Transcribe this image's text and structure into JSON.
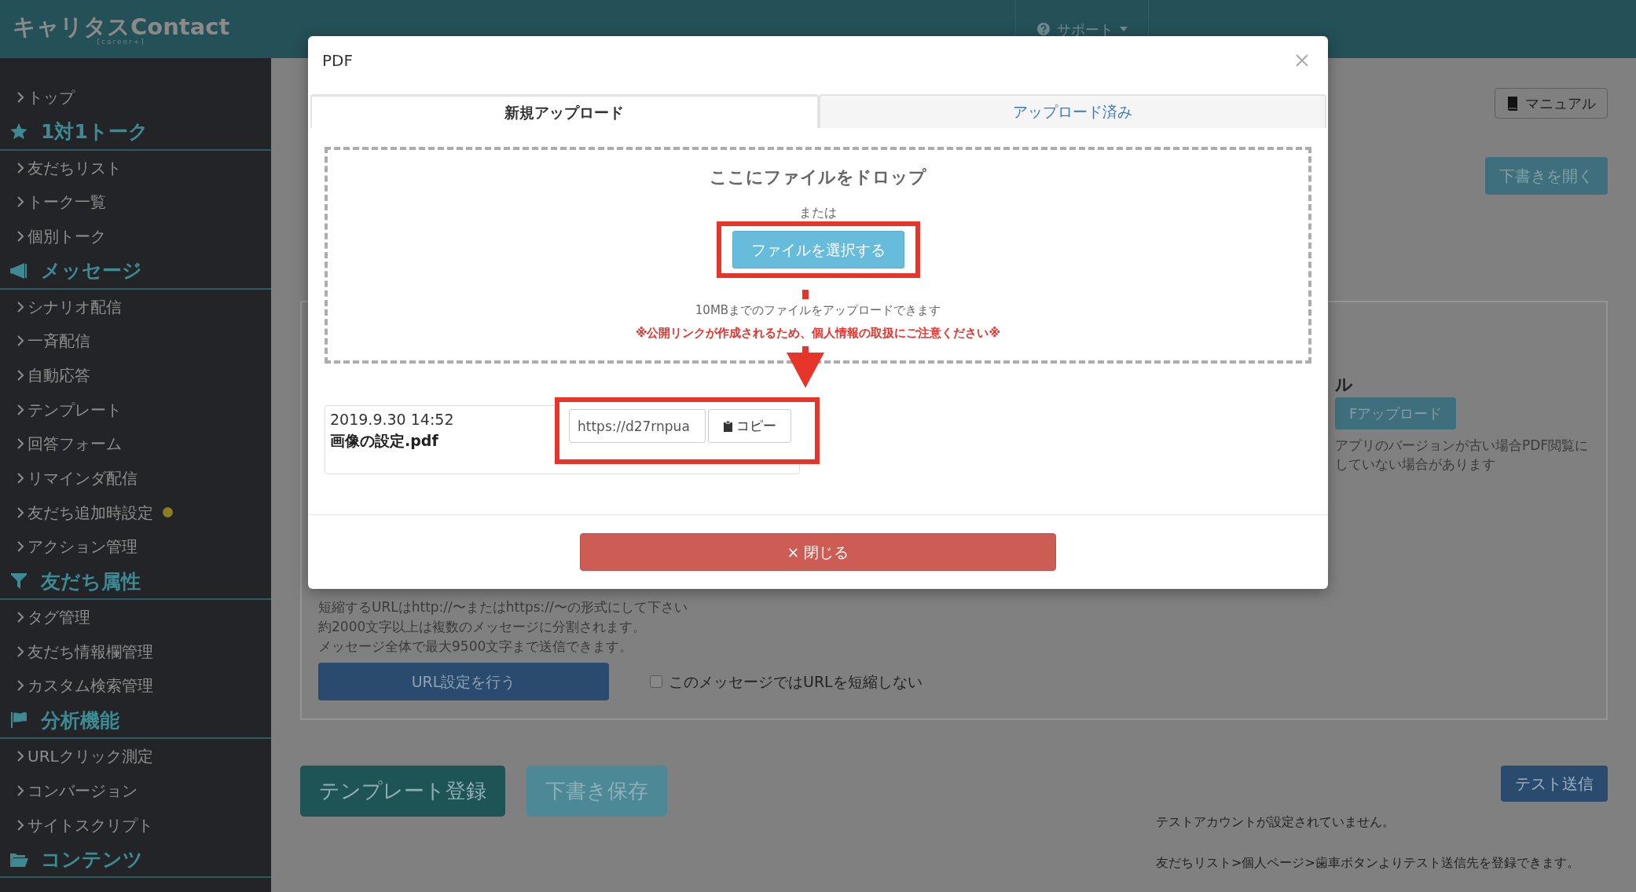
{
  "header": {
    "logo": "キャリタスContact",
    "logo_sub": "[career+]",
    "support_menu": "サポート"
  },
  "sidebar": [
    {
      "kind": "item",
      "label": "トップ",
      "notice": false
    },
    {
      "kind": "heading",
      "label": "1対1トーク"
    },
    {
      "kind": "item",
      "label": "友だちリスト",
      "notice": false
    },
    {
      "kind": "item",
      "label": "トーク一覧",
      "notice": false
    },
    {
      "kind": "item",
      "label": "個別トーク",
      "notice": false
    },
    {
      "kind": "heading",
      "label": "メッセージ"
    },
    {
      "kind": "item",
      "label": "シナリオ配信",
      "notice": false
    },
    {
      "kind": "item",
      "label": "一斉配信",
      "notice": false
    },
    {
      "kind": "item",
      "label": "自動応答",
      "notice": false
    },
    {
      "kind": "item",
      "label": "テンプレート",
      "notice": false
    },
    {
      "kind": "item",
      "label": "回答フォーム",
      "notice": false
    },
    {
      "kind": "item",
      "label": "リマインダ配信",
      "notice": false
    },
    {
      "kind": "item",
      "label": "友だち追加時設定",
      "notice": true
    },
    {
      "kind": "item",
      "label": "アクション管理",
      "notice": false
    },
    {
      "kind": "heading",
      "label": "友だち属性"
    },
    {
      "kind": "item",
      "label": "タグ管理",
      "notice": false
    },
    {
      "kind": "item",
      "label": "友だち情報欄管理",
      "notice": false
    },
    {
      "kind": "item",
      "label": "カスタム検索管理",
      "notice": false
    },
    {
      "kind": "heading",
      "label": "分析機能"
    },
    {
      "kind": "item",
      "label": "URLクリック測定",
      "notice": false
    },
    {
      "kind": "item",
      "label": "コンバージョン",
      "notice": false
    },
    {
      "kind": "item",
      "label": "サイトスクリプト",
      "notice": false
    },
    {
      "kind": "heading",
      "label": "コンテンツ"
    }
  ],
  "page": {
    "manual_button": "マニュアル",
    "open_draft_button": "下書きを開く",
    "panel": {
      "heading": "ル",
      "upload_button": "Fアップロード",
      "notes": [
        "アプリのバージョンが古い場合PDF閲覧に",
        "していない場合があります"
      ],
      "hints": [
        "短縮するURLはhttp://〜またはhttps://〜の形式にして下さい",
        "約2000文字以上は複数のメッセージに分割されます。",
        "メッセージ全体で最大9500文字まで送信できます。"
      ],
      "url_button": "URL設定を行う",
      "shorten_checkbox": {
        "label": "このメッセージではURLを短縮しない",
        "checked": false
      }
    },
    "template_button": "テンプレート登録",
    "save_draft_button": "下書き保存",
    "test_send_button": "テスト送信",
    "test_notes": [
      "テストアカウントが設定されていません。",
      "友だちリスト>個人ページ>歯車ボタンよりテスト送信先を登録できます。"
    ]
  },
  "modal": {
    "title": "PDF",
    "tabs": [
      {
        "label": "新規アップロード",
        "selected": true
      },
      {
        "label": "アップロード済み",
        "selected": false
      }
    ],
    "dropzone": {
      "heading": "ここにファイルをドロップ",
      "or_text": "または",
      "select_button": "ファイルを選択する",
      "size_note": "10MBまでのファイルをアップロードできます",
      "warning": "※公開リンクが作成されるため、個人情報の取扱にご注意ください※"
    },
    "files": [
      {
        "date": "2019.9.30 14:52",
        "name": "画像の設定.pdf",
        "url": "https://d27rnpua",
        "copy_button": "コピー"
      }
    ],
    "close_button": {
      "icon": "×",
      "label": "閉じる"
    }
  }
}
